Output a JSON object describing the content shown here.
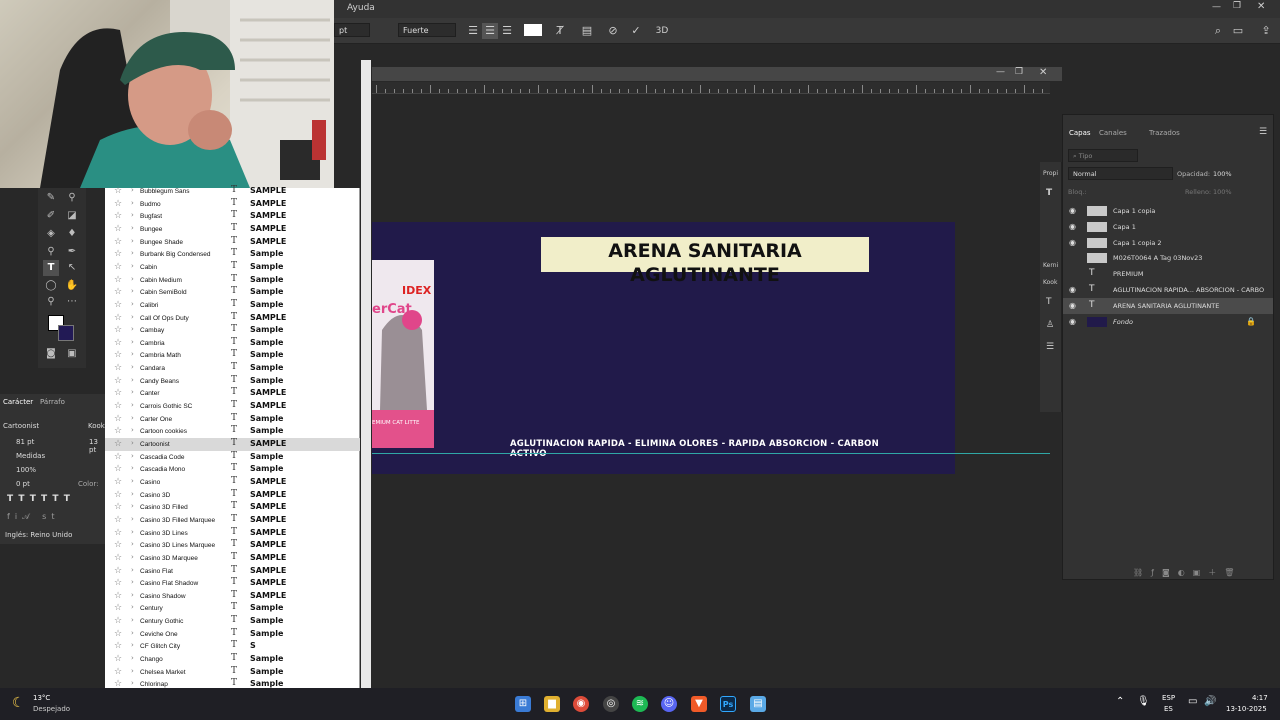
{
  "menubar": {
    "items": [
      "Ayuda"
    ]
  },
  "options_bar": {
    "font_size_field": "pt",
    "antialias": "Fuerte",
    "align_left": "≡",
    "three_d": "3D"
  },
  "font_list": {
    "rows": [
      {
        "name": "Bubblegum Sans",
        "sample": "SAMPLE"
      },
      {
        "name": "Budmo",
        "sample": "SAMPLE"
      },
      {
        "name": "Bugfast",
        "sample": "SAMPLE"
      },
      {
        "name": "Bungee",
        "sample": "SAMPLE"
      },
      {
        "name": "Bungee Shade",
        "sample": "SAMPLE"
      },
      {
        "name": "Burbank Big Condensed",
        "sample": "Sample"
      },
      {
        "name": "Cabin",
        "sample": "Sample"
      },
      {
        "name": "Cabin Medium",
        "sample": "Sample"
      },
      {
        "name": "Cabin SemiBold",
        "sample": "Sample"
      },
      {
        "name": "Calibri",
        "sample": "Sample"
      },
      {
        "name": "Call Of Ops Duty",
        "sample": "SAMPLE"
      },
      {
        "name": "Cambay",
        "sample": "Sample"
      },
      {
        "name": "Cambria",
        "sample": "Sample"
      },
      {
        "name": "Cambria Math",
        "sample": "Sample"
      },
      {
        "name": "Candara",
        "sample": "Sample"
      },
      {
        "name": "Candy Beans",
        "sample": "Sample"
      },
      {
        "name": "Canter",
        "sample": "SAMPLE"
      },
      {
        "name": "Carrois Gothic SC",
        "sample": "SAMPLE"
      },
      {
        "name": "Carter One",
        "sample": "Sample"
      },
      {
        "name": "Cartoon cookies",
        "sample": "Sample"
      },
      {
        "name": "Cartoonist",
        "sample": "SAMPLE"
      },
      {
        "name": "Cascadia Code",
        "sample": "Sample"
      },
      {
        "name": "Cascadia Mono",
        "sample": "Sample"
      },
      {
        "name": "Casino",
        "sample": "SAMPLE"
      },
      {
        "name": "Casino 3D",
        "sample": "SAMPLE"
      },
      {
        "name": "Casino 3D Filled",
        "sample": "SAMPLE"
      },
      {
        "name": "Casino 3D Filled Marquee",
        "sample": "SAMPLE"
      },
      {
        "name": "Casino 3D Lines",
        "sample": "SAMPLE"
      },
      {
        "name": "Casino 3D Lines Marquee",
        "sample": "SAMPLE"
      },
      {
        "name": "Casino 3D Marquee",
        "sample": "SAMPLE"
      },
      {
        "name": "Casino Flat",
        "sample": "SAMPLE"
      },
      {
        "name": "Casino Flat Shadow",
        "sample": "SAMPLE"
      },
      {
        "name": "Casino Shadow",
        "sample": "SAMPLE"
      },
      {
        "name": "Century",
        "sample": "Sample"
      },
      {
        "name": "Century Gothic",
        "sample": "Sample"
      },
      {
        "name": "Ceviche One",
        "sample": "Sample"
      },
      {
        "name": "CF Glitch City",
        "sample": "S"
      },
      {
        "name": "Chango",
        "sample": "Sample"
      },
      {
        "name": "Chelsea Market",
        "sample": "Sample"
      },
      {
        "name": "Chlorinap",
        "sample": "Sample"
      }
    ]
  },
  "character_panel": {
    "tab_character": "Carácter",
    "tab_paragraph": "Párrafo",
    "font_family": "Cartoonist",
    "font_style": "Kook",
    "font_size": "81 pt",
    "leading": "13 pt",
    "kerning": "Medidas",
    "tracking": "100%",
    "baseline": "0 pt",
    "color_label": "Color:",
    "language": "Inglés: Reino Unido"
  },
  "canvas": {
    "title_text": "ARENA SANITARIA AGLUTINANTE",
    "subtitle_text": "AGLUTINACION RAPIDA - ELIMINA OLORES - RAPIDA ABSORCION - CARBON ACTIVO",
    "product_label": "IDEX",
    "product_brand": "erCat",
    "product_caption": "EMIUM CAT LITTE"
  },
  "layers_panel": {
    "tab_layers": "Capas",
    "tab_channels": "Canales",
    "tab_paths": "Trazados",
    "search_placeholder": "Tipo",
    "blend_mode": "Normal",
    "opacity_label": "Opacidad:",
    "opacity_value": "100%",
    "lock_label": "Bloq.:",
    "fill_label": "Relleno:",
    "fill_value": "100%",
    "layers": [
      {
        "name": "Capa 1 copia",
        "type": "raster",
        "visible": true
      },
      {
        "name": "Capa 1",
        "type": "raster",
        "visible": true
      },
      {
        "name": "Capa 1 copia 2",
        "type": "raster",
        "visible": true
      },
      {
        "name": "M026T0064 A Tag   03Nov23",
        "type": "raster",
        "visible": false
      },
      {
        "name": "PREMIUM",
        "type": "text",
        "visible": false
      },
      {
        "name": "AGLUTINACION RAPIDA... ABSORCION - CARBO",
        "type": "text",
        "visible": true
      },
      {
        "name": "ARENA SANITARIA AGLUTINANTE",
        "type": "text",
        "visible": true
      },
      {
        "name": "Fondo",
        "type": "background",
        "visible": true
      }
    ]
  },
  "props_panel": {
    "label": "Propi",
    "kerning_label": "Kerni",
    "kook": "Kook"
  },
  "taskbar": {
    "weather_temp": "13°C",
    "weather_desc": "Despejado",
    "lang_1": "ESP",
    "lang_2": "ES",
    "time": "4:17",
    "date": "13-10-2025",
    "colors": {
      "bg": "#1f1f25"
    }
  },
  "colors": {
    "artboard": "#211a4a",
    "title_bg": "#f1eec9",
    "guide": "#2fa7a6"
  }
}
